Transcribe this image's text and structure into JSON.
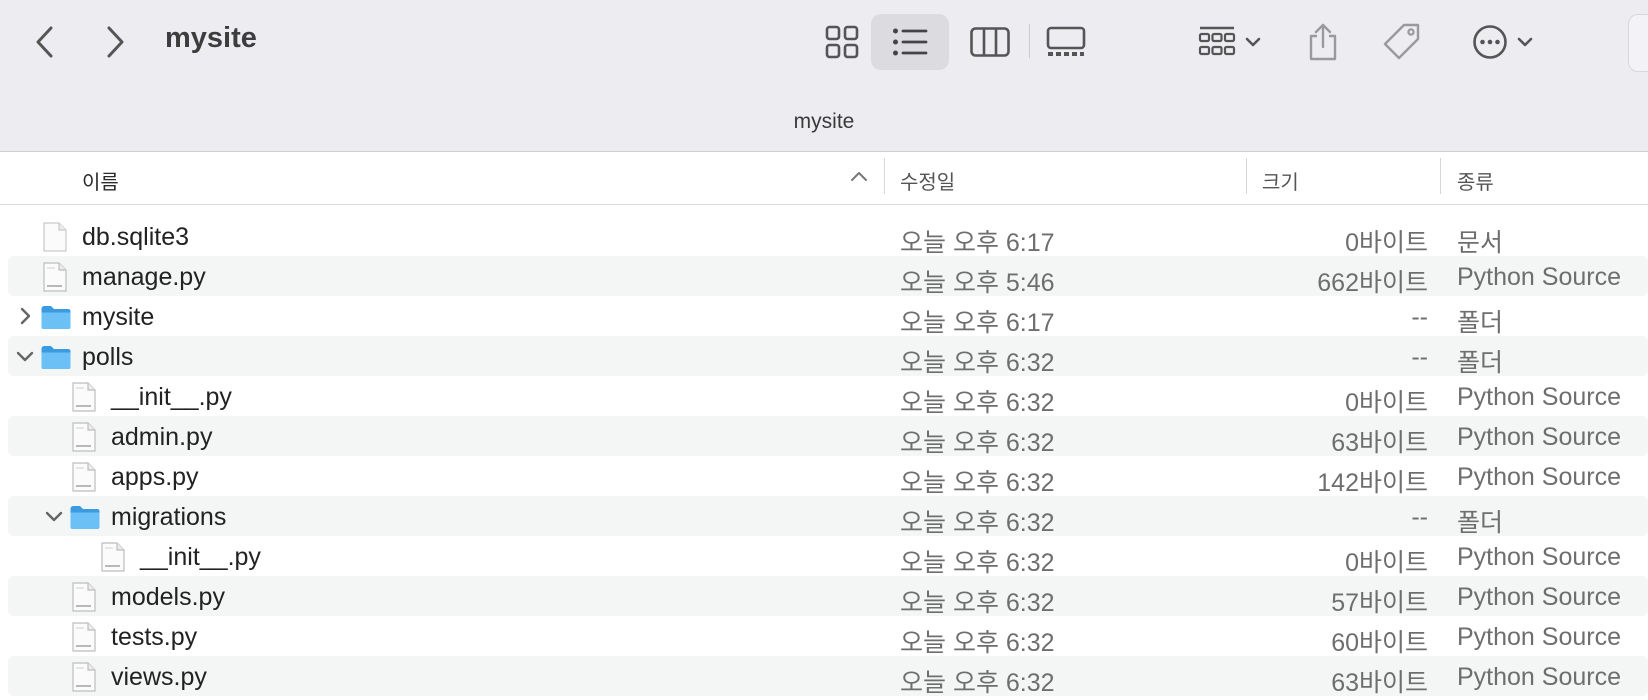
{
  "window": {
    "title": "mysite",
    "path_title": "mysite"
  },
  "toolbar": {
    "icons": [
      "chevron-left-icon",
      "chevron-right-icon",
      "grid-view-icon",
      "list-view-icon",
      "column-view-icon",
      "gallery-view-icon",
      "group-icon",
      "share-icon",
      "tag-icon",
      "more-icon"
    ]
  },
  "columns": {
    "name": "이름",
    "date": "수정일",
    "size": "크기",
    "kind": "종류"
  },
  "colors": {
    "toolbar_bg": "#edecf1",
    "folder_blue": "#5ab4f0",
    "row_alt": "#f4f5f5",
    "selected_view_bg": "#dcdbe0"
  },
  "files": [
    {
      "name": "db.sqlite3",
      "date": "오늘 오후 6:17",
      "size": "0바이트",
      "kind": "문서",
      "type": "file",
      "level": 0
    },
    {
      "name": "manage.py",
      "date": "오늘 오후 5:46",
      "size": "662바이트",
      "kind": "Python Source",
      "type": "python",
      "level": 0
    },
    {
      "name": "mysite",
      "date": "오늘 오후 6:17",
      "size": "--",
      "kind": "폴더",
      "type": "folder",
      "level": 0,
      "expanded": false
    },
    {
      "name": "polls",
      "date": "오늘 오후 6:32",
      "size": "--",
      "kind": "폴더",
      "type": "folder",
      "level": 0,
      "expanded": true
    },
    {
      "name": "__init__.py",
      "date": "오늘 오후 6:32",
      "size": "0바이트",
      "kind": "Python Source",
      "type": "python",
      "level": 1
    },
    {
      "name": "admin.py",
      "date": "오늘 오후 6:32",
      "size": "63바이트",
      "kind": "Python Source",
      "type": "python",
      "level": 1
    },
    {
      "name": "apps.py",
      "date": "오늘 오후 6:32",
      "size": "142바이트",
      "kind": "Python Source",
      "type": "python",
      "level": 1
    },
    {
      "name": "migrations",
      "date": "오늘 오후 6:32",
      "size": "--",
      "kind": "폴더",
      "type": "folder",
      "level": 1,
      "expanded": true
    },
    {
      "name": "__init__.py",
      "date": "오늘 오후 6:32",
      "size": "0바이트",
      "kind": "Python Source",
      "type": "python",
      "level": 2
    },
    {
      "name": "models.py",
      "date": "오늘 오후 6:32",
      "size": "57바이트",
      "kind": "Python Source",
      "type": "python",
      "level": 1
    },
    {
      "name": "tests.py",
      "date": "오늘 오후 6:32",
      "size": "60바이트",
      "kind": "Python Source",
      "type": "python",
      "level": 1
    },
    {
      "name": "views.py",
      "date": "오늘 오후 6:32",
      "size": "63바이트",
      "kind": "Python Source",
      "type": "python",
      "level": 1
    }
  ]
}
